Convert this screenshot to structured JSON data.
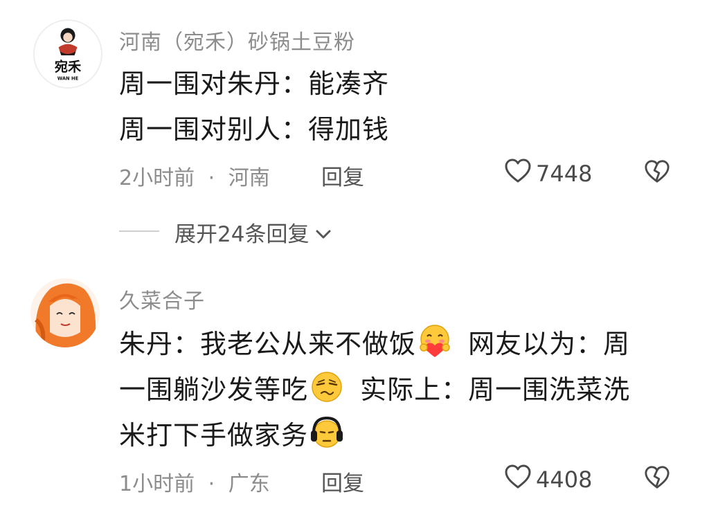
{
  "comments": [
    {
      "username": "河南（宛禾）砂锅土豆粉",
      "avatar_text": "宛禾",
      "avatar_subtext": "WAN HE",
      "lines": [
        "周一围对朱丹：能凑齐",
        "周一围对别人：得加钱"
      ],
      "time": "2小时前",
      "location": "河南",
      "reply_label": "回复",
      "likes": "7448",
      "expand_label": "展开24条回复"
    },
    {
      "username": "久菜合子",
      "lines": [
        {
          "a": "朱丹：我老公从来不做饭",
          "b": "网友以为：周"
        },
        {
          "a": "一围躺沙发等吃",
          "b": "实际上：周一围洗菜洗"
        },
        {
          "a": "米打下手做家务",
          "b": ""
        }
      ],
      "time": "1小时前",
      "location": "广东",
      "reply_label": "回复",
      "likes": "4408"
    }
  ],
  "separator": "·",
  "icons": {
    "like": "heart-outline-icon",
    "dislike": "broken-heart-icon",
    "expand": "chevron-down-icon",
    "emoji1": "heart-hug-emoji-icon",
    "emoji2": "smirk-emoji-icon",
    "emoji3": "headphones-emoji-icon"
  },
  "colors": {
    "text": "#1a1a1a",
    "muted": "#8c8c8c",
    "brand_red": "#c23a2a",
    "hair_orange": "#f07a2a"
  }
}
